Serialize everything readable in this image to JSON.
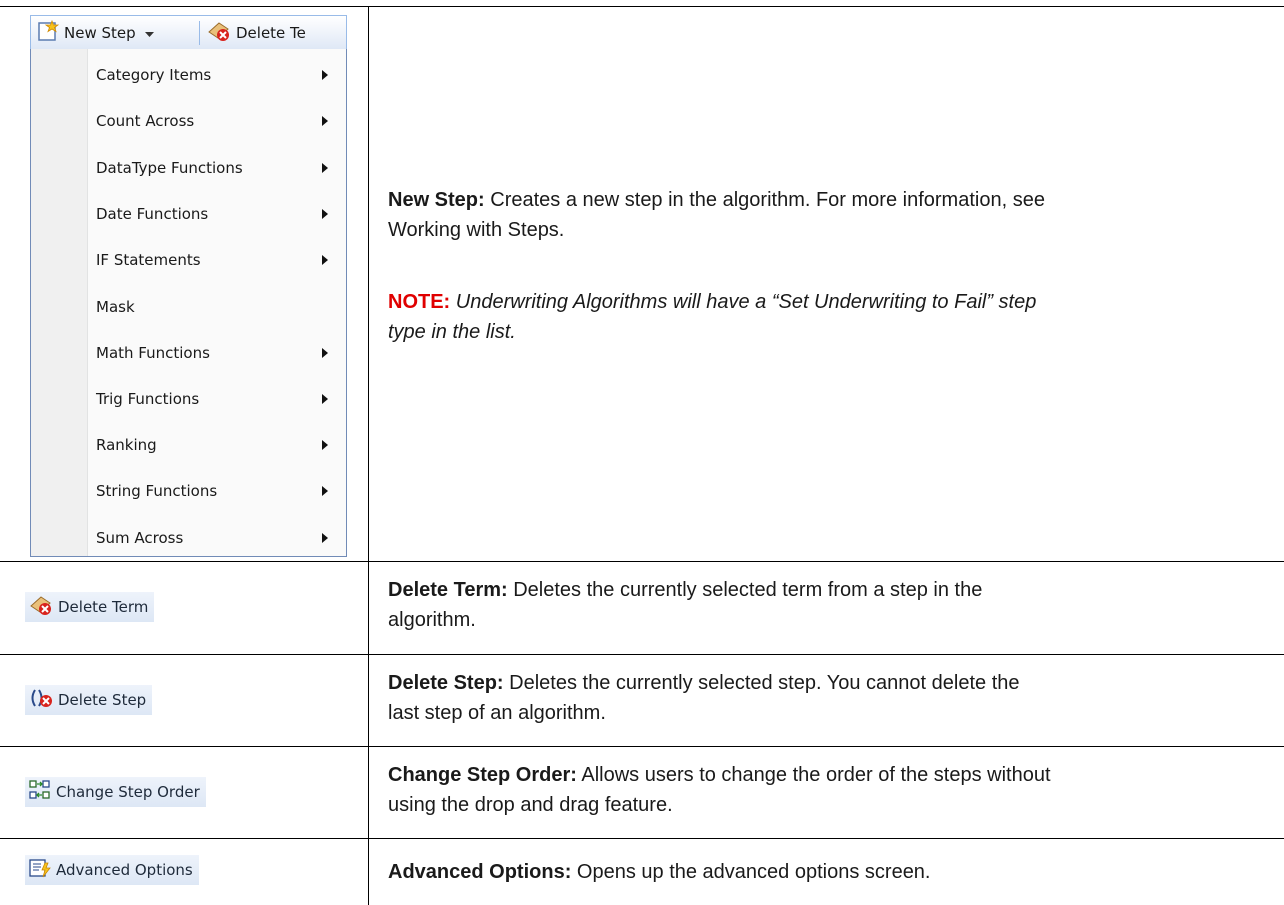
{
  "toolbar": {
    "new_step_label": "New Step",
    "delete_term_label": "Delete Te"
  },
  "menu": {
    "items": [
      {
        "label": "Category Items",
        "submenu": true
      },
      {
        "label": "Count Across",
        "submenu": true
      },
      {
        "label": "DataType Functions",
        "submenu": true
      },
      {
        "label": "Date Functions",
        "submenu": true
      },
      {
        "label": "IF Statements",
        "submenu": true
      },
      {
        "label": "Mask",
        "submenu": false
      },
      {
        "label": "Math Functions",
        "submenu": true
      },
      {
        "label": "Trig Functions",
        "submenu": true
      },
      {
        "label": "Ranking",
        "submenu": true
      },
      {
        "label": "String Functions",
        "submenu": true
      },
      {
        "label": "Sum Across",
        "submenu": true
      }
    ]
  },
  "rows": {
    "new_step": {
      "term": "New Step:",
      "desc1": " Creates a new step in the algorithm. For more information, see",
      "desc2": "Working with Steps.",
      "note_label": "NOTE:",
      "note1": " Underwriting Algorithms will have a “Set Underwriting to Fail” step",
      "note2": "type in the list."
    },
    "delete_term": {
      "button": "Delete Term",
      "term": "Delete Term:",
      "desc1": " Deletes the currently selected term from a step in the",
      "desc2": "algorithm."
    },
    "delete_step": {
      "button": "Delete Step",
      "term": "Delete Step:",
      "desc1": " Deletes the currently selected step. You cannot delete the",
      "desc2": "last step of an algorithm."
    },
    "change_step_order": {
      "button": "Change Step Order",
      "term": "Change Step Order:",
      "desc1": " Allows users to change the order of the steps without",
      "desc2": "using the drop and drag feature."
    },
    "advanced_options": {
      "button": "Advanced Options",
      "term": "Advanced Options:",
      "desc1": " Opens up the advanced options screen."
    }
  },
  "colors": {
    "note": "#e00000",
    "toolbar_border": "#99bbe8"
  }
}
